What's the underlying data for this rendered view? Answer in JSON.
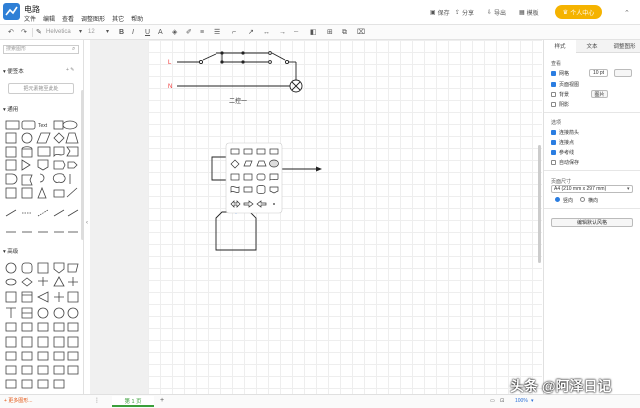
{
  "app": {
    "title": "电路",
    "accent": "#2e7fd6"
  },
  "menu": [
    "文件",
    "编辑",
    "查看",
    "调整图形",
    "其它",
    "帮助"
  ],
  "header": {
    "save": "保存",
    "share": "分享",
    "export": "导出",
    "templates": "模板",
    "help": "帮助",
    "upgrade": "个人中心"
  },
  "toolbar": {
    "font": "Helvetica",
    "font_size": "12",
    "bold": "B",
    "italic": "I",
    "underline": "U",
    "text_color": "A"
  },
  "left": {
    "search_placeholder": "搜索图形",
    "scratchpad": "便签本",
    "scratch_add": "+ ✎",
    "scratch_drop": "把元素拖至此处",
    "general": "通用",
    "text_shape": "Text",
    "advanced": "高级",
    "more": "+ 更多图形..."
  },
  "canvas": {
    "L": "L",
    "N": "N",
    "caption": "二控一"
  },
  "right": {
    "tabs": [
      "样式",
      "文本",
      "调整图形"
    ],
    "view_title": "查看",
    "grid": "网格",
    "grid_size": "10 pt",
    "page_view": "页面视图",
    "background": "背景",
    "shadow": "阴影",
    "image_btn": "图片",
    "options_title": "选项",
    "connection_arrows": "连接箭头",
    "connection_points": "连接点",
    "guides": "参考线",
    "autosave": "自动保存",
    "page_size_title": "页面尺寸",
    "page_size": "A4 (210 mm x 297 mm)",
    "portrait": "竖向",
    "landscape": "横向",
    "edit_style": "编辑默认风格"
  },
  "bottom": {
    "page_tab": "第 1 页",
    "zoom": "100%"
  },
  "watermark": "头条 @阿泽日记"
}
